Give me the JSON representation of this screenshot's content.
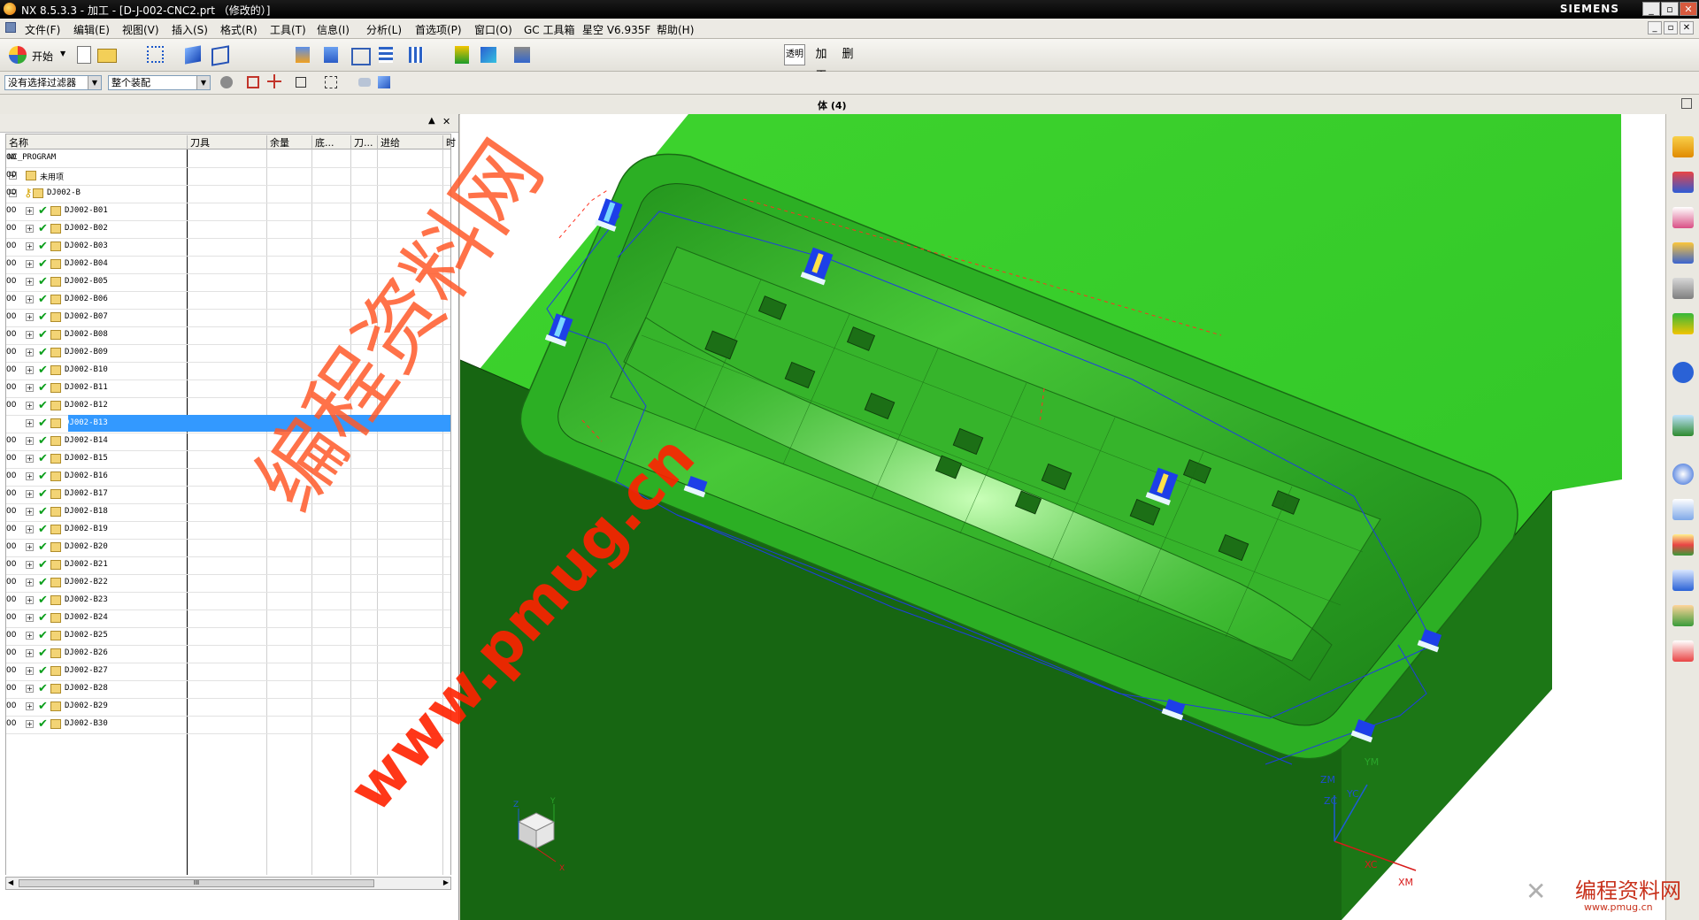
{
  "window": {
    "title": "NX 8.5.3.3 - 加工 - [D-J-002-CNC2.prt （修改的）]",
    "brand": "SIEMENS",
    "controls": [
      "_",
      "▫",
      "✕"
    ]
  },
  "menu": {
    "items": [
      "文件(F)",
      "编辑(E)",
      "视图(V)",
      "插入(S)",
      "格式(R)",
      "工具(T)",
      "信息(I)",
      "分析(L)",
      "首选项(P)",
      "窗口(O)",
      "GC 工具箱",
      "星空 V6.935F",
      "帮助(H)"
    ]
  },
  "toolbar": {
    "start_label": "开始",
    "text_buttons": [
      "透明",
      "加工",
      "删"
    ]
  },
  "selection_bar": {
    "filter_value": "没有选择过滤器",
    "scope_value": "整个装配"
  },
  "view": {
    "title": "体 (4)"
  },
  "navigator": {
    "columns": [
      "名称",
      "刀具",
      "余量",
      "底...",
      "刀...",
      "进给",
      "时"
    ],
    "root": "NC_PROGRAM",
    "unused": "未用项",
    "group": "DJ002-B",
    "operations": [
      "DJ002-B01",
      "DJ002-B02",
      "DJ002-B03",
      "DJ002-B04",
      "DJ002-B05",
      "DJ002-B06",
      "DJ002-B07",
      "DJ002-B08",
      "DJ002-B09",
      "DJ002-B10",
      "DJ002-B11",
      "DJ002-B12",
      "DJ002-B13",
      "DJ002-B14",
      "DJ002-B15",
      "DJ002-B16",
      "DJ002-B17",
      "DJ002-B18",
      "DJ002-B19",
      "DJ002-B20",
      "DJ002-B21",
      "DJ002-B22",
      "DJ002-B23",
      "DJ002-B24",
      "DJ002-B25",
      "DJ002-B26",
      "DJ002-B27",
      "DJ002-B28",
      "DJ002-B29",
      "DJ002-B30"
    ],
    "selected_operation": "DJ002-B13",
    "time_col_value": "00",
    "scroll_mark": "III"
  },
  "csys_labels": {
    "zm": "ZM",
    "zc": "ZC",
    "yc": "YC",
    "ym": "YM",
    "xc": "XC",
    "xm": "XM",
    "triad_x": "X",
    "triad_y": "Y",
    "triad_z": "Z"
  },
  "watermark": {
    "big_text": "编程资料网",
    "url_text": "www.pmug.cn",
    "corner_text": "编程资料网",
    "corner_url": "www.pmug.cn"
  },
  "colors": {
    "part_green": "#32cd28",
    "selection_blue": "#3399ff",
    "watermark_red": "#ff3300"
  }
}
